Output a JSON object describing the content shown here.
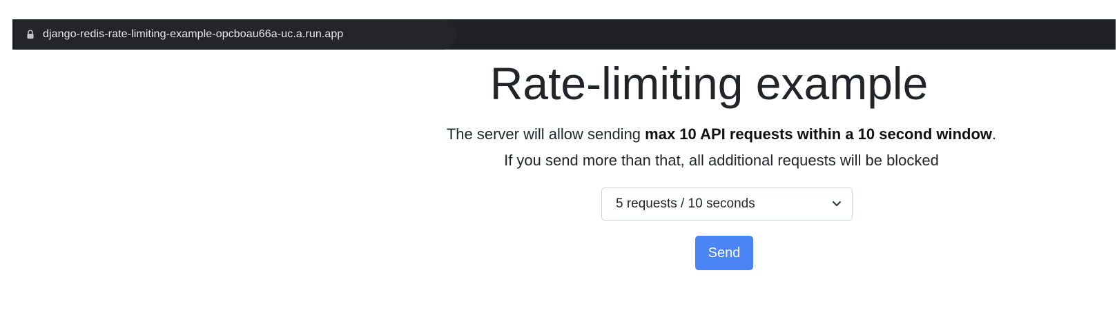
{
  "browser": {
    "url": "django-redis-rate-limiting-example-opcboau66a-uc.a.run.app",
    "lock_icon": "lock-icon"
  },
  "page": {
    "title": "Rate-limiting example",
    "description": {
      "line1_prefix": "The server will allow sending ",
      "line1_bold": "max 10 API requests within a 10 second window",
      "line1_suffix": ".",
      "line2": "If you send more than that, all additional requests will be blocked"
    },
    "select": {
      "selected": "5 requests / 10 seconds",
      "icon": "chevron-down-icon"
    },
    "send_label": "Send"
  },
  "colors": {
    "browser_bar": "#1f2124",
    "button": "#4a84f5",
    "text": "#212529"
  }
}
